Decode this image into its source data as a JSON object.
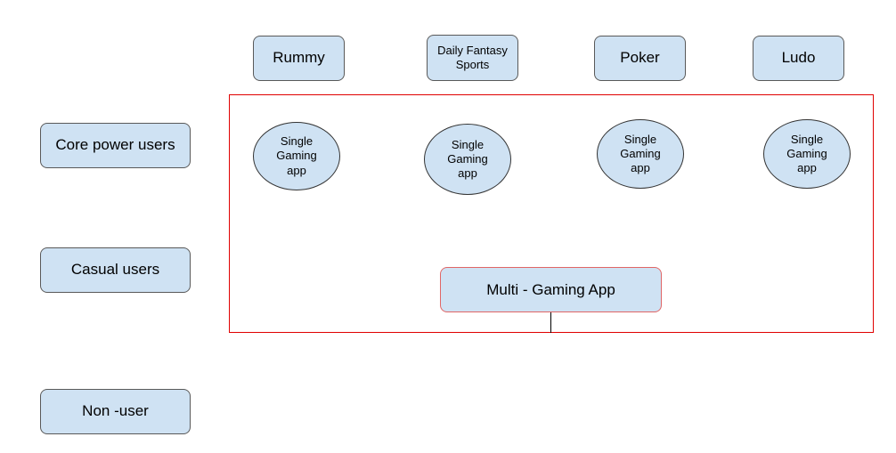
{
  "games": [
    {
      "label": "Rummy"
    },
    {
      "label": "Daily Fantasy Sports"
    },
    {
      "label": "Poker"
    },
    {
      "label": "Ludo"
    }
  ],
  "segments": [
    {
      "label": "Core power users"
    },
    {
      "label": "Casual users"
    },
    {
      "label": "Non -user"
    }
  ],
  "single_apps": [
    {
      "label": "Single\nGaming\napp"
    },
    {
      "label": "Single\nGaming\napp"
    },
    {
      "label": "Single\nGaming\napp"
    },
    {
      "label": "Single\nGaming\napp"
    }
  ],
  "multi_app": {
    "label": "Multi - Gaming App"
  },
  "colors": {
    "node_fill": "#cfe2f3",
    "frame": "#e00000",
    "multi_border": "#e06666"
  }
}
